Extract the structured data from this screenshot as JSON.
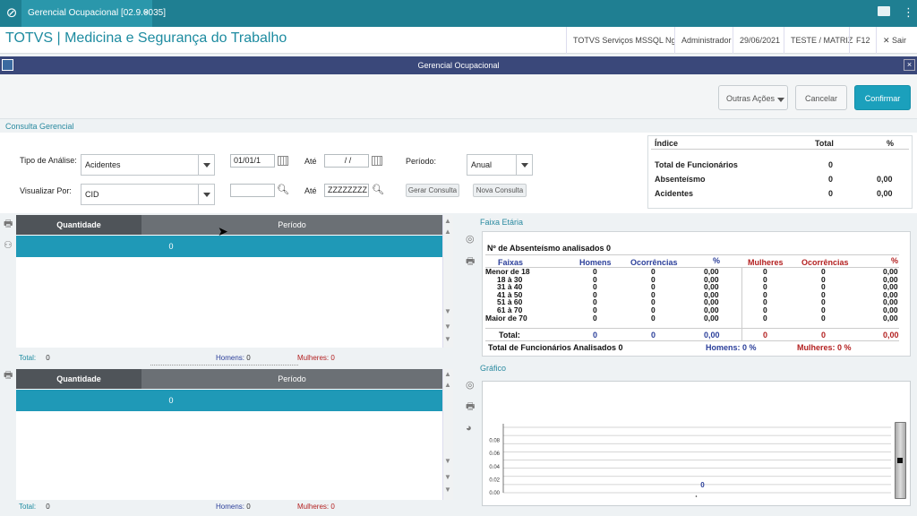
{
  "topbar": {
    "tab_title": "Gerencial Ocupacional [02.9.0035]",
    "tab_close": "×",
    "icons": [
      "totvs-logo-icon",
      "mail-icon",
      "menu-icon"
    ]
  },
  "header": {
    "brand": "TOTVS | Medicina e Segurança do Trabalho",
    "env": "TOTVS Serviços MSSQL Ng",
    "user": "Administrador",
    "date": "29/06/2021",
    "company": "TESTE / MATRIZ",
    "key": "F12",
    "exit": "Sair"
  },
  "window": {
    "title": "Gerencial Ocupacional"
  },
  "toolbar": {
    "outras": "Outras Ações",
    "cancelar": "Cancelar",
    "confirmar": "Confirmar"
  },
  "section": {
    "title": "Consulta Gerencial"
  },
  "query": {
    "tipo_label": "Tipo de Análise:",
    "tipo_value": "Acidentes",
    "visualizar_label": "Visualizar Por:",
    "visualizar_value": "CID",
    "date_from": "01/01/1",
    "ate1": "Até",
    "date_to": " /  / ",
    "periodo_label": "Período:",
    "periodo_value": "Anual",
    "cid_from": "",
    "ate2": "Até",
    "cid_to": "ZZZZZZZZ",
    "gerar": "Gerar Consulta",
    "nova": "Nova Consulta"
  },
  "index_table": {
    "headers": [
      "Índice",
      "Total",
      "%"
    ],
    "rows": [
      [
        "Total de Funcionários",
        "0",
        ""
      ],
      [
        "Absenteísmo",
        "0",
        "0,00"
      ],
      [
        "Acidentes",
        "0",
        "0,00"
      ]
    ]
  },
  "grid1": {
    "col_qtd": "Quantidade",
    "col_periodo": "Período",
    "row_value": "0",
    "total_label": "Total:",
    "total_value": "0",
    "homens_label": "Homens:",
    "homens_value": "0",
    "mulheres_label": "Mulheres:",
    "mulheres_value": "0"
  },
  "grid2": {
    "col_qtd": "Quantidade",
    "col_periodo": "Período",
    "row_value": "0",
    "total_label": "Total:",
    "total_value": "0",
    "homens_label": "Homens:",
    "homens_value": "0",
    "mulheres_label": "Mulheres:",
    "mulheres_value": "0"
  },
  "faixa": {
    "section_title": "Faixa Etária",
    "heading": "Nº de Absenteísmo analisados 0",
    "cols": {
      "faixas": "Faixas",
      "homens": "Homens",
      "ocor_h": "Ocorrências",
      "pct_h": "%",
      "mulheres": "Mulheres",
      "ocor_m": "Ocorrências",
      "pct_m": "%"
    },
    "rows": [
      {
        "faixa": "Menor de 18",
        "h": "0",
        "oh": "0",
        "ph": "0,00",
        "m": "0",
        "om": "0",
        "pm": "0,00"
      },
      {
        "faixa": "18 à 30",
        "h": "0",
        "oh": "0",
        "ph": "0,00",
        "m": "0",
        "om": "0",
        "pm": "0,00"
      },
      {
        "faixa": "31 à 40",
        "h": "0",
        "oh": "0",
        "ph": "0,00",
        "m": "0",
        "om": "0",
        "pm": "0,00"
      },
      {
        "faixa": "41 à 50",
        "h": "0",
        "oh": "0",
        "ph": "0,00",
        "m": "0",
        "om": "0",
        "pm": "0,00"
      },
      {
        "faixa": "51 à 60",
        "h": "0",
        "oh": "0",
        "ph": "0,00",
        "m": "0",
        "om": "0",
        "pm": "0,00"
      },
      {
        "faixa": "61 à 70",
        "h": "0",
        "oh": "0",
        "ph": "0,00",
        "m": "0",
        "om": "0",
        "pm": "0,00"
      },
      {
        "faixa": "Maior de 70",
        "h": "0",
        "oh": "0",
        "ph": "0,00",
        "m": "0",
        "om": "0",
        "pm": "0,00"
      }
    ],
    "total": {
      "label": "Total:",
      "h": "0",
      "oh": "0",
      "ph": "0,00",
      "m": "0",
      "om": "0",
      "pm": "0,00"
    },
    "footer": {
      "analisados": "Total de Funcionários Analisados 0",
      "homens": "Homens: 0 %",
      "mulheres": "Mulheres: 0 %"
    }
  },
  "grafico": {
    "section_title": "Gráfico"
  },
  "chart_data": {
    "type": "bar",
    "categories": [
      ""
    ],
    "values": [
      0
    ],
    "data_labels": [
      "0"
    ],
    "ylim": [
      0,
      0.1
    ],
    "yticks": [
      "0.00",
      "0.02",
      "0.04",
      "0.06",
      "0.08"
    ],
    "grid": true,
    "accent": "#2b3f9a"
  },
  "colors": {
    "topbar": "#1f7f92",
    "accent": "#1ba0bc",
    "selected_row": "#1f99b7",
    "window_bar": "#3a487a"
  }
}
